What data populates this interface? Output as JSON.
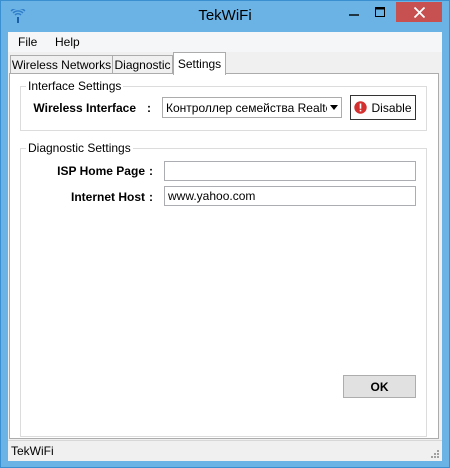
{
  "window": {
    "title": "TekWiFi",
    "minimize_glyph": "–",
    "maximize_glyph": "□",
    "close_glyph": "✕"
  },
  "menu": {
    "file": "File",
    "help": "Help"
  },
  "tabs": [
    {
      "label": "Wireless Networks",
      "active": false
    },
    {
      "label": "Diagnostic",
      "active": false
    },
    {
      "label": "Settings",
      "active": true
    }
  ],
  "interface_settings": {
    "legend": "Interface Settings",
    "wireless_interface_label": "Wireless Interface",
    "colon": ":",
    "wireless_interface_value": "Контроллер семейства Realtek",
    "disable_button": "Disable"
  },
  "diagnostic_settings": {
    "legend": "Diagnostic Settings",
    "isp_label": "ISP Home Page",
    "isp_value": "",
    "host_label": "Internet Host",
    "host_value": "www.yahoo.com",
    "colon": ":"
  },
  "ok_button": "OK",
  "status": {
    "text": "TekWiFi"
  },
  "colors": {
    "frame": "#6bb3e4",
    "close_button": "#c75050",
    "disable_icon": "#d32f2f"
  },
  "icons": {
    "app": "wifi-signal-icon",
    "disable": "error-icon"
  }
}
